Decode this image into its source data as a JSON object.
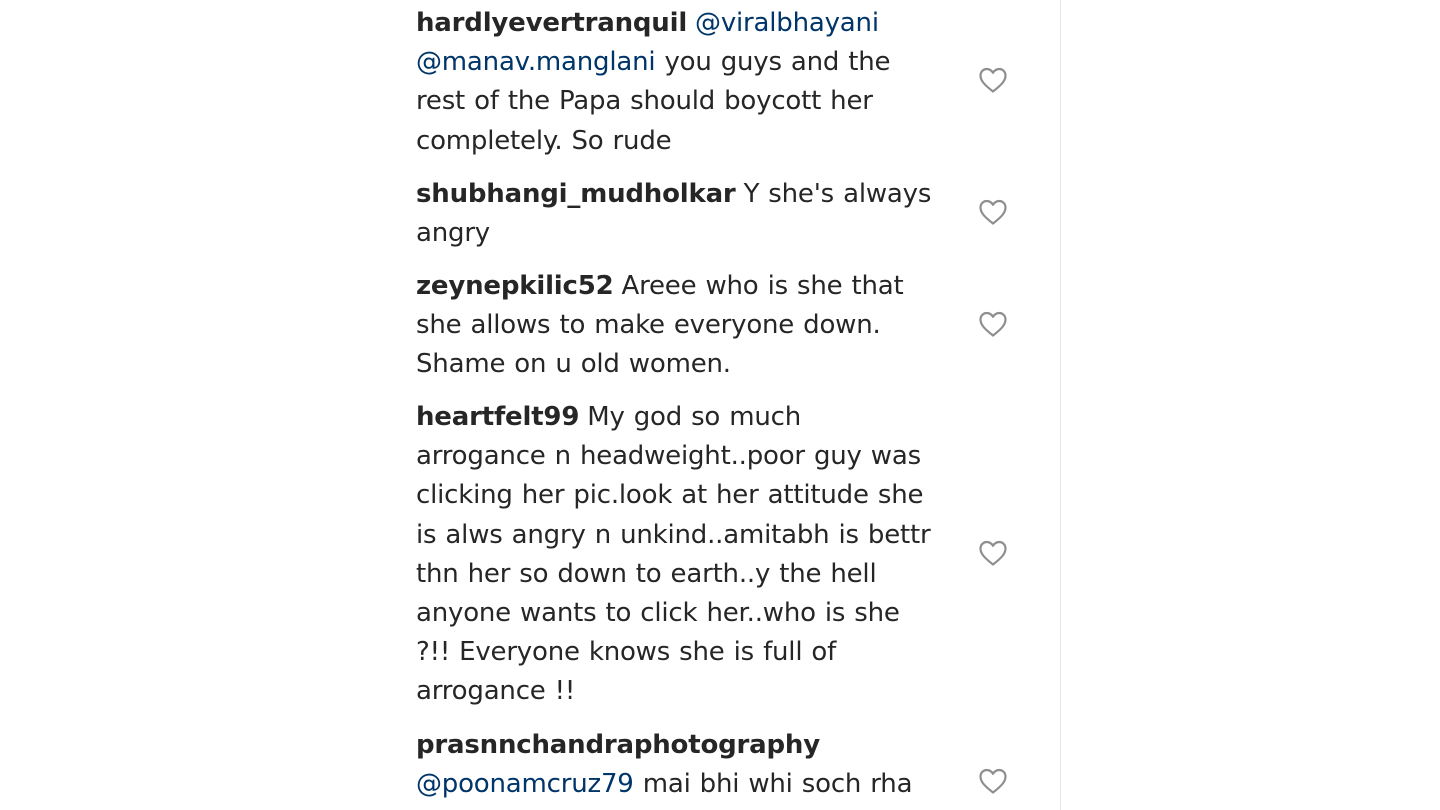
{
  "comments": [
    {
      "username": "hardlyevertranquil",
      "lines": [
        {
          "mention": "@viralbhayani",
          "text": ""
        },
        {
          "mention": "@manav.manglani",
          "text": " you guys and the"
        },
        {
          "mention": "",
          "text": "rest of the Papa should boycott her"
        },
        {
          "mention": "",
          "text": "completely. So rude"
        }
      ]
    },
    {
      "username": "shubhangi_mudholkar",
      "lines": [
        {
          "mention": "",
          "text": "Y she's always"
        },
        {
          "mention": "",
          "text": "angry"
        }
      ]
    },
    {
      "username": "zeynepkilic52",
      "lines": [
        {
          "mention": "",
          "text": "Areee who is she that"
        },
        {
          "mention": "",
          "text": "she allows to make everyone down."
        },
        {
          "mention": "",
          "text": "Shame on u old women."
        }
      ]
    },
    {
      "username": "heartfelt99",
      "lines": [
        {
          "mention": "",
          "text": "My god so much"
        },
        {
          "mention": "",
          "text": "arrogance n headweight..poor guy was"
        },
        {
          "mention": "",
          "text": "clicking her pic.look at her attitude she"
        },
        {
          "mention": "",
          "text": "is alws angry n unkind..amitabh is bettr"
        },
        {
          "mention": "",
          "text": "thn her so down to earth..y the hell"
        },
        {
          "mention": "",
          "text": "anyone wants to click her..who is she"
        },
        {
          "mention": "",
          "text": "?!! Everyone knows she is full of"
        },
        {
          "mention": "",
          "text": "arrogance !!"
        }
      ]
    },
    {
      "username": "prasnnchandraphotography",
      "lines": [
        {
          "mention": "",
          "text": ""
        },
        {
          "mention": "@poonamcruz79",
          "text": " mai bhi whi soch rha"
        }
      ]
    }
  ],
  "icons": {
    "like": "heart-outline-icon"
  },
  "colors": {
    "text": "#262626",
    "mention": "#003569",
    "icon": "#8e8e8e",
    "divider": "#e6e6e6"
  }
}
